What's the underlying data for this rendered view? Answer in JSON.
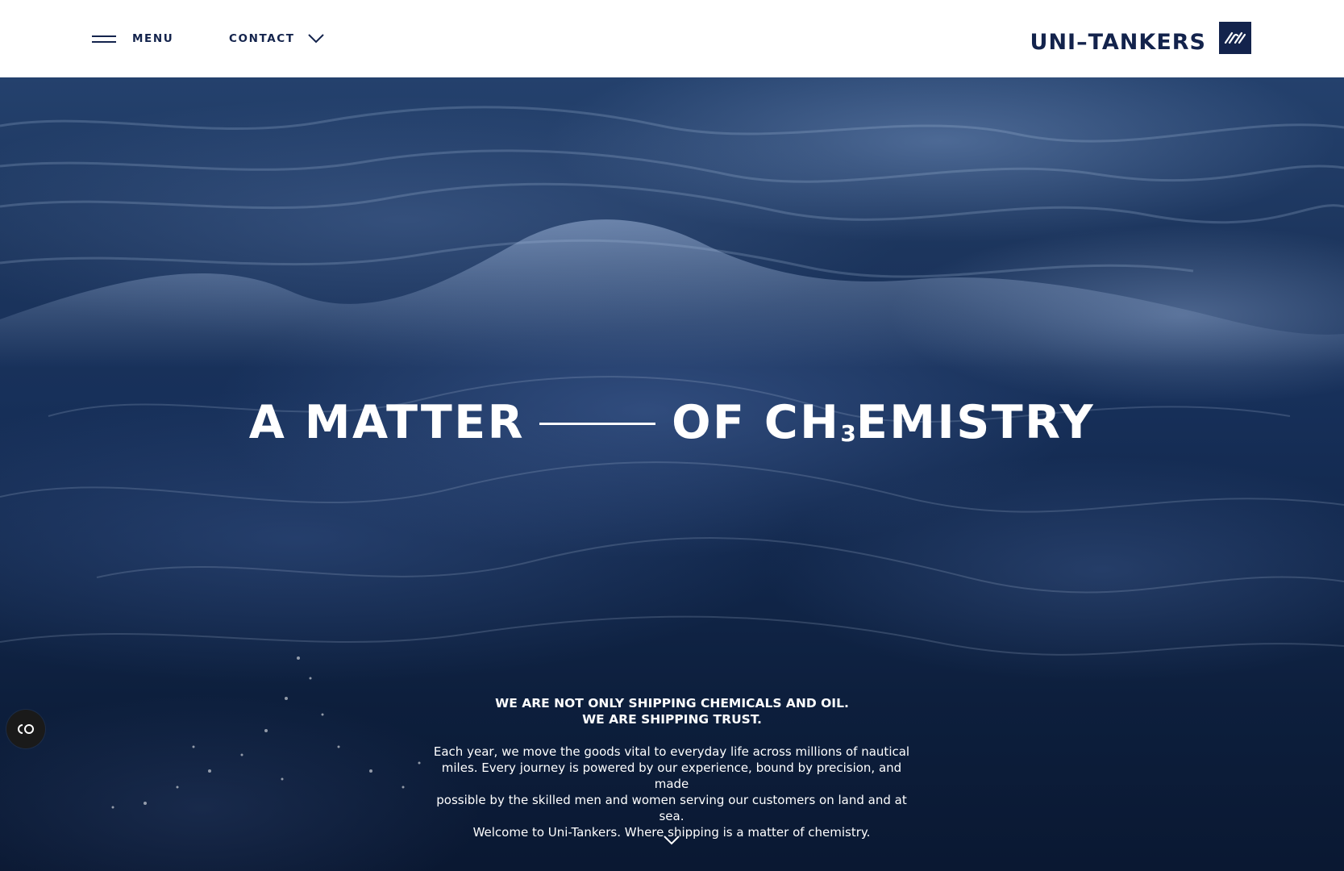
{
  "header": {
    "menu_label": "MENU",
    "contact_label": "CONTACT",
    "logo_text": "UNI–TANKERS"
  },
  "hero": {
    "title_left": "A MATTER",
    "title_right_prefix": "OF CH",
    "title_subscript": "3",
    "title_right_suffix": "EMISTRY",
    "tagline_line1": "WE ARE NOT ONLY SHIPPING CHEMICALS AND OIL.",
    "tagline_line2": "WE ARE SHIPPING TRUST.",
    "body_line1": "Each year, we move the goods vital to everyday life across millions of nautical",
    "body_line2": "miles. Every journey is powered by our experience, bound by precision, and made",
    "body_line3": "possible by the skilled men and women serving our customers on land and at sea.",
    "body_line4": "Welcome to Uni-Tankers. Where shipping is a matter of chemistry."
  },
  "icons": {
    "menu": "hamburger-icon",
    "contact_toggle": "chevron-down-icon",
    "logo_mark": "uni-tankers-logo-icon",
    "scroll": "chevron-down-icon",
    "accessibility": "accessibility-icon"
  },
  "colors": {
    "brand_navy": "#13234c",
    "header_bg": "#ffffff",
    "hero_text": "#ffffff",
    "a11y_button_bg": "#1a1a1a"
  }
}
